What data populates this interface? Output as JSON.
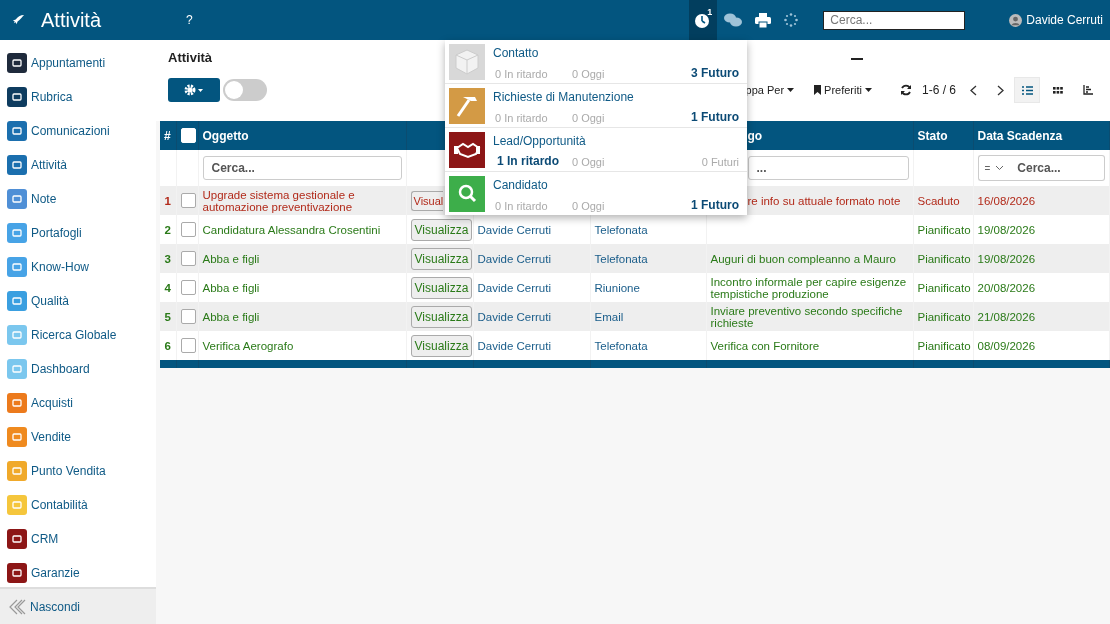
{
  "top_bar": {
    "title": "Attività",
    "help": "?",
    "notifications": {
      "badge": "1",
      "open": true
    },
    "search": {
      "placeholder": "Cerca..."
    },
    "user": "Davide Cerruti"
  },
  "sidebar": {
    "items": [
      {
        "label": "Appuntamenti",
        "color": "#1f2a3c"
      },
      {
        "label": "Rubrica",
        "color": "#0e3c5f"
      },
      {
        "label": "Comunicazioni",
        "color": "#1b6fae"
      },
      {
        "label": "Attività",
        "color": "#1b6fae"
      },
      {
        "label": "Note",
        "color": "#4f8fd6"
      },
      {
        "label": "Portafogli",
        "color": "#47a3e6"
      },
      {
        "label": "Know-How",
        "color": "#47a3e6"
      },
      {
        "label": "Qualità",
        "color": "#3a9fe0"
      },
      {
        "label": "Ricerca Globale",
        "color": "#7bc7ee"
      },
      {
        "label": "Dashboard",
        "color": "#7bc7ee"
      },
      {
        "label": "Acquisti",
        "color": "#ec7a1c"
      },
      {
        "label": "Vendite",
        "color": "#ef8a1f"
      },
      {
        "label": "Punto Vendita",
        "color": "#f0a92a"
      },
      {
        "label": "Contabilità",
        "color": "#f5c63c"
      },
      {
        "label": "CRM",
        "color": "#8c1616"
      },
      {
        "label": "Garanzie",
        "color": "#8c1616"
      }
    ],
    "hide_label": "Nascondi"
  },
  "panel": {
    "title": "Attività",
    "toggle_on": false,
    "toolbar": {
      "group_by": "ppa Per",
      "favorites": "Preferiti",
      "pager": "1-6 / 6"
    },
    "table": {
      "select_all_checked": false,
      "columns": [
        {
          "label": "#"
        },
        {
          "label": "Oggetto"
        },
        {},
        {},
        {},
        {
          "label": "go",
          "covered": true
        },
        {
          "label": "Stato"
        },
        {
          "label": "Data Scadenza"
        }
      ],
      "filters": {
        "subject_placeholder": "Cerca...",
        "description_placeholder": "...",
        "date_operator": "=",
        "date_placeholder": "Cerca..."
      },
      "rows": [
        {
          "n": "1",
          "checked": false,
          "subject": "Upgrade sistema gestionale e automazione preventivazione",
          "action": "Visual",
          "description": "re info su attuale formato note",
          "covered": true,
          "status": "Scaduto",
          "overdue": true,
          "due": "16/08/2026"
        },
        {
          "n": "2",
          "checked": false,
          "subject": "Candidatura Alessandra Crosentini",
          "action": "Visualizza",
          "user": "Davide Cerruti",
          "type": "Telefonata",
          "status": "Pianificato",
          "overdue": false,
          "due": "19/08/2026"
        },
        {
          "n": "3",
          "checked": false,
          "subject": "Abba e figli",
          "action": "Visualizza",
          "user": "Davide Cerruti",
          "type": "Telefonata",
          "description": "Auguri di buon compleanno a Mauro",
          "status": "Pianificato",
          "overdue": false,
          "due": "19/08/2026"
        },
        {
          "n": "4",
          "checked": false,
          "subject": "Abba e figli",
          "action": "Visualizza",
          "user": "Davide Cerruti",
          "type": "Riunione",
          "description": "Incontro informale per capire esigenze tempistiche produzione",
          "status": "Pianificato",
          "overdue": false,
          "due": "20/08/2026"
        },
        {
          "n": "5",
          "checked": false,
          "subject": "Abba e figli",
          "action": "Visualizza",
          "user": "Davide Cerruti",
          "type": "Email",
          "description": "Inviare preventivo secondo specifiche richieste",
          "status": "Pianificato",
          "overdue": false,
          "due": "21/08/2026"
        },
        {
          "n": "6",
          "checked": false,
          "subject": "Verifica Aerografo",
          "action": "Visualizza",
          "user": "Davide Cerruti",
          "type": "Telefonata",
          "description": "Verifica con Fornitore",
          "status": "Pianificato",
          "overdue": false,
          "due": "08/09/2026"
        }
      ]
    }
  },
  "activity_menu": {
    "items": [
      {
        "kind": "cube",
        "title": "Contatto",
        "color": "#d8d8d8",
        "counts": [
          {
            "text": "0 In ritardo",
            "highlighted": false
          },
          {
            "text": "0 Oggi",
            "highlighted": false
          },
          {
            "text": "3 Futuro",
            "highlighted": true
          }
        ]
      },
      {
        "kind": "hammer",
        "title": "Richieste di Manutenzione",
        "color": "#d39a45",
        "counts": [
          {
            "text": "0 In ritardo",
            "highlighted": false
          },
          {
            "text": "0 Oggi",
            "highlighted": false
          },
          {
            "text": "1 Futuro",
            "highlighted": true
          }
        ]
      },
      {
        "kind": "handshake",
        "title": "Lead/Opportunità",
        "color": "#8c1616",
        "counts": [
          {
            "text": "1 In ritardo",
            "highlighted": true
          },
          {
            "text": "0 Oggi",
            "highlighted": false
          },
          {
            "text": "0 Futuri",
            "highlighted": false
          }
        ]
      },
      {
        "kind": "search",
        "title": "Candidato",
        "color": "#3dae4a",
        "counts": [
          {
            "text": "0 In ritardo",
            "highlighted": false
          },
          {
            "text": "0 Oggi",
            "highlighted": false
          },
          {
            "text": "1 Futuro",
            "highlighted": true
          }
        ]
      }
    ]
  }
}
